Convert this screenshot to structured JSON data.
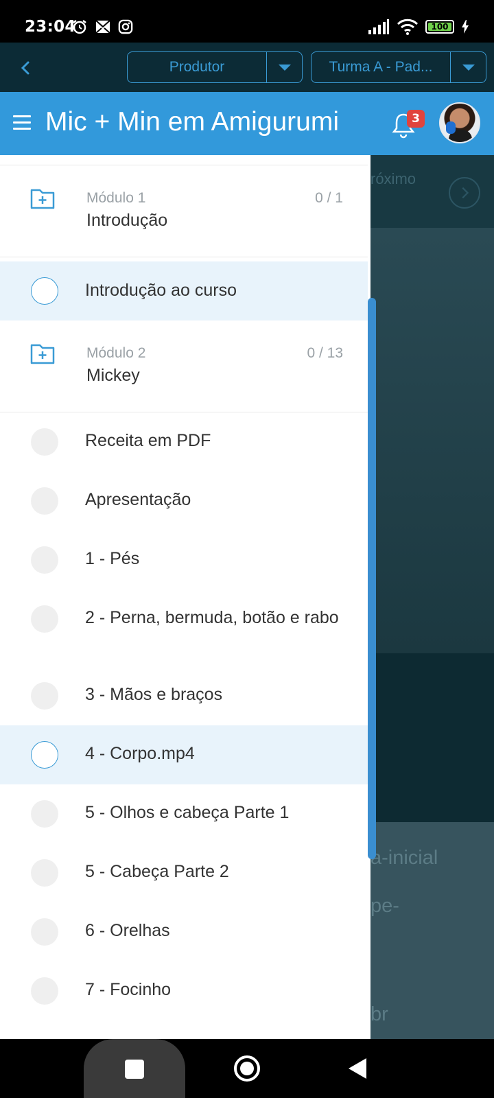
{
  "status_bar": {
    "time": "23:04",
    "battery": "100",
    "icons": [
      "alarm-icon",
      "mail-icon",
      "instagram-icon",
      "signal-icon",
      "wifi-icon",
      "battery-icon",
      "charging-icon"
    ]
  },
  "topbar": {
    "role_select": "Produtor",
    "class_select": "Turma A - Pad..."
  },
  "header": {
    "title": "Mic + Min em Amigurumi",
    "notifications": "3"
  },
  "background": {
    "next_label": "róximo",
    "line1": "a-inicial",
    "line2": "pe-",
    "line3": "br"
  },
  "drawer": {
    "modules": [
      {
        "number": "Módulo 1",
        "name": "Introdução",
        "progress": "0 / 1"
      },
      {
        "number": "Módulo 2",
        "name": "Mickey",
        "progress": "0 / 13"
      }
    ],
    "module1_lessons": [
      {
        "label": "Introdução ao curso",
        "active": true
      }
    ],
    "module2_lessons": [
      {
        "label": "Receita em PDF"
      },
      {
        "label": "Apresentação"
      },
      {
        "label": "1 - Pés"
      },
      {
        "label": "2 - Perna, bermuda, botão e rabo"
      },
      {
        "label": "3 - Mãos e braços"
      },
      {
        "label": "4 - Corpo.mp4",
        "active": true
      },
      {
        "label": "5 - Olhos e cabeça Parte 1"
      },
      {
        "label": "5 - Cabeça Parte 2"
      },
      {
        "label": "6 - Orelhas"
      },
      {
        "label": "7 - Focinho"
      }
    ]
  },
  "colors": {
    "accent": "#3299db",
    "dark_bar": "#0c2b36",
    "active_row": "#e8f3fb",
    "badge": "#e0443e"
  }
}
